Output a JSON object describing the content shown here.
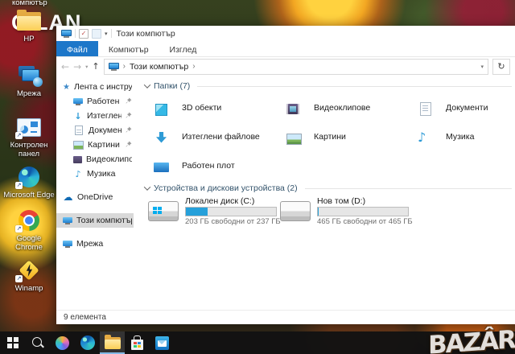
{
  "desktop": {
    "cut_label": "компютър",
    "watermark": "C.LAN",
    "icons": [
      {
        "label": "HP"
      },
      {
        "label": "Мрежа"
      },
      {
        "label": "Контролен панел"
      },
      {
        "label": "Microsoft Edge"
      },
      {
        "label": "Google Chrome"
      },
      {
        "label": "Winamp"
      }
    ]
  },
  "window": {
    "title": "Този компютър",
    "tabs": [
      {
        "label": "Файл"
      },
      {
        "label": "Компютър"
      },
      {
        "label": "Изглед"
      }
    ],
    "breadcrumb": {
      "root": "Този компютър",
      "sep": "›",
      "back": "←",
      "forward": "→",
      "up": "↑",
      "refresh": "↻",
      "dropdown": "▾"
    },
    "nav": {
      "items": [
        {
          "label": "Лента с инструменти"
        },
        {
          "label": "Работен плот"
        },
        {
          "label": "Изтеглени файл"
        },
        {
          "label": "Документи"
        },
        {
          "label": "Картини"
        },
        {
          "label": "Видеоклипове"
        },
        {
          "label": "Музика"
        },
        {
          "label": "OneDrive"
        },
        {
          "label": "Този компютър"
        },
        {
          "label": "Мрежа"
        }
      ]
    },
    "folders_group": {
      "title": "Папки (7)",
      "items": [
        {
          "label": "3D обекти"
        },
        {
          "label": "Видеоклипове"
        },
        {
          "label": "Документи"
        },
        {
          "label": "Изтеглени файлове"
        },
        {
          "label": "Картини"
        },
        {
          "label": "Музика"
        },
        {
          "label": "Работен плот"
        }
      ]
    },
    "devices_group": {
      "title": "Устройства и дискови устройства (2)",
      "drives": [
        {
          "name": "Локален диск (C:)",
          "free": "203 ГБ свободни от 237 ГБ",
          "used_style": "width:24%"
        },
        {
          "name": "Нов том (D:)",
          "free": "465 ГБ свободни от 465 ГБ",
          "used_style": "width:1%"
        }
      ]
    },
    "status": "9 елемента",
    "qat_check": "✓"
  },
  "brand": {
    "logo": "BAZÂR"
  },
  "colors": {
    "accent": "#1d77c9",
    "drive_fill": "#26a0da",
    "folder": "#fbce55",
    "selection": "#d9d9d9",
    "taskbar": "#121212"
  }
}
